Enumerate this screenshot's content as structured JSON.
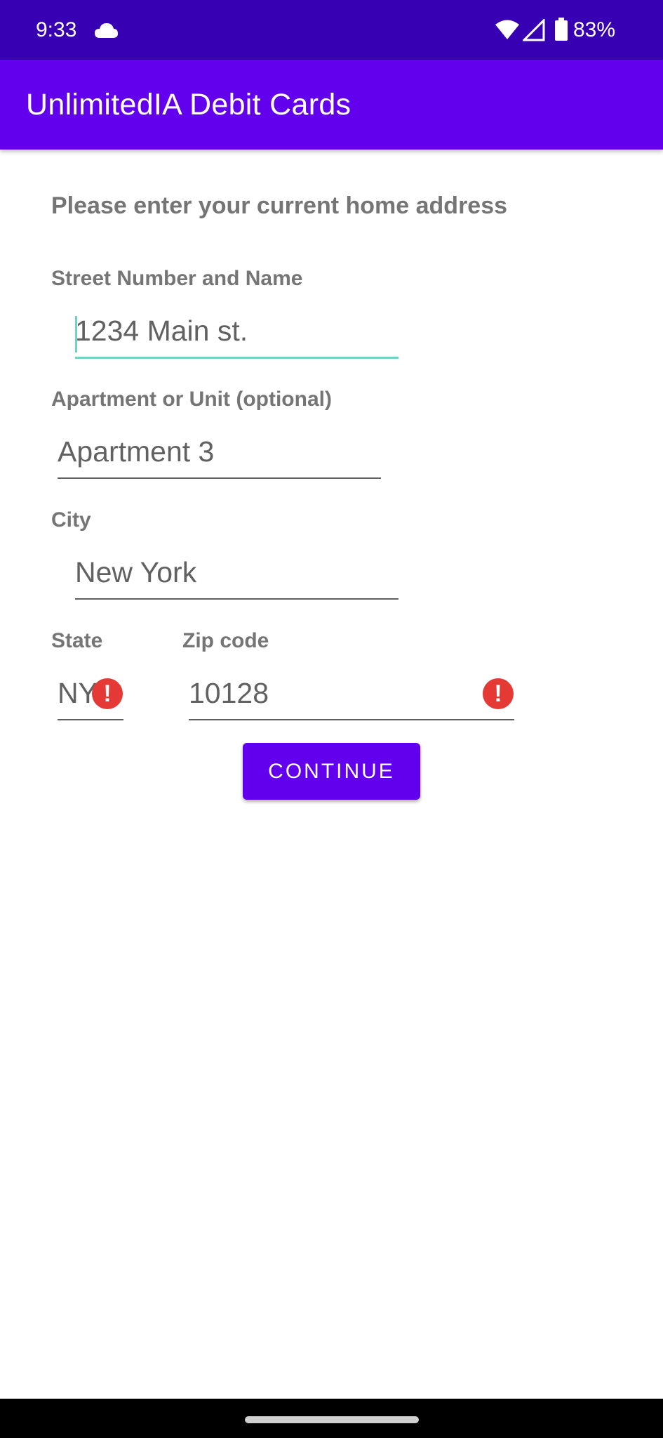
{
  "status_bar": {
    "time": "9:33",
    "battery": "83%",
    "icons": [
      "cloud-icon",
      "wifi-icon",
      "cell-signal-icon",
      "battery-icon"
    ]
  },
  "app_bar": {
    "title": "UnlimitedIA Debit Cards"
  },
  "form": {
    "prompt": "Please enter your current home address",
    "street": {
      "label": "Street Number and Name",
      "value": "1234 Main st."
    },
    "apartment": {
      "label": "Apartment or Unit (optional)",
      "value": "Apartment 3"
    },
    "city": {
      "label": "City",
      "value": "New York"
    },
    "state": {
      "label": "State",
      "value": "NY",
      "error_icon": "!"
    },
    "zip": {
      "label": "Zip code",
      "value": "10128",
      "error_icon": "!"
    },
    "continue_label": "CONTINUE"
  },
  "colors": {
    "status_bar": "#3700b3",
    "primary": "#6200ee",
    "focus_accent": "#6fd3c1",
    "error": "#e53935"
  }
}
